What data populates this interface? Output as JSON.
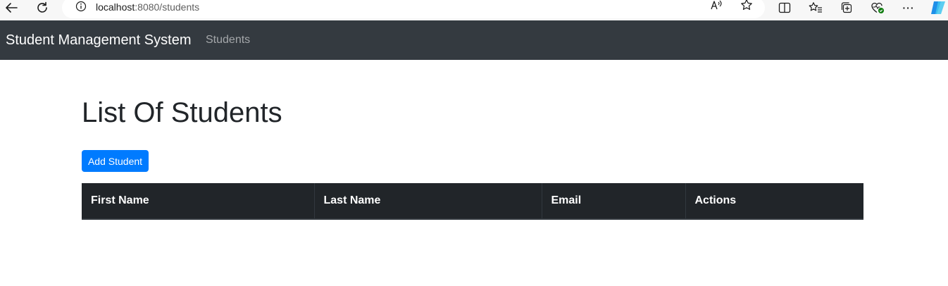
{
  "browser": {
    "url_host": "localhost",
    "url_rest": ":8080/students",
    "icons": [
      "back-icon",
      "reload-icon",
      "info-icon",
      "read-aloud-icon",
      "favorite-star-icon",
      "split-screen-icon",
      "favorites-icon",
      "collections-icon",
      "browser-essentials-icon",
      "more-icon",
      "copilot-icon"
    ],
    "more_label": "···"
  },
  "navbar": {
    "brand": "Student Management System",
    "links": [
      {
        "label": "Students"
      }
    ],
    "background": "#343a40"
  },
  "main": {
    "title": "List Of Students",
    "add_button_label": "Add Student",
    "add_button_color": "#007bff",
    "table": {
      "columns": [
        "First Name",
        "Last Name",
        "Email",
        "Actions"
      ],
      "rows": [],
      "header_background": "#212529"
    }
  }
}
